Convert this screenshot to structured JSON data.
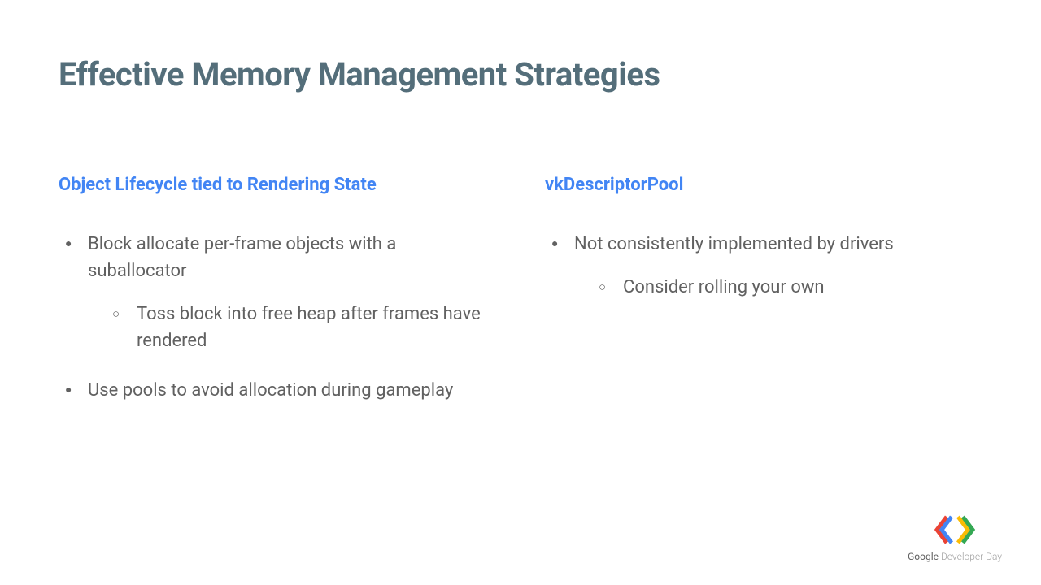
{
  "title": "Effective Memory Management Strategies",
  "left": {
    "heading": "Object Lifecycle tied to Rendering State",
    "items": [
      {
        "text": "Block allocate per-frame objects with a suballocator",
        "sub": [
          "Toss block into free heap after frames have rendered"
        ]
      },
      {
        "text": "Use pools to avoid allocation during gameplay",
        "sub": []
      }
    ]
  },
  "right": {
    "heading": "vkDescriptorPool",
    "items": [
      {
        "text": "Not consistently implemented by drivers",
        "sub": [
          "Consider rolling your own"
        ]
      }
    ]
  },
  "footer": {
    "brand1": "Google",
    "brand2": " Developer Day"
  }
}
